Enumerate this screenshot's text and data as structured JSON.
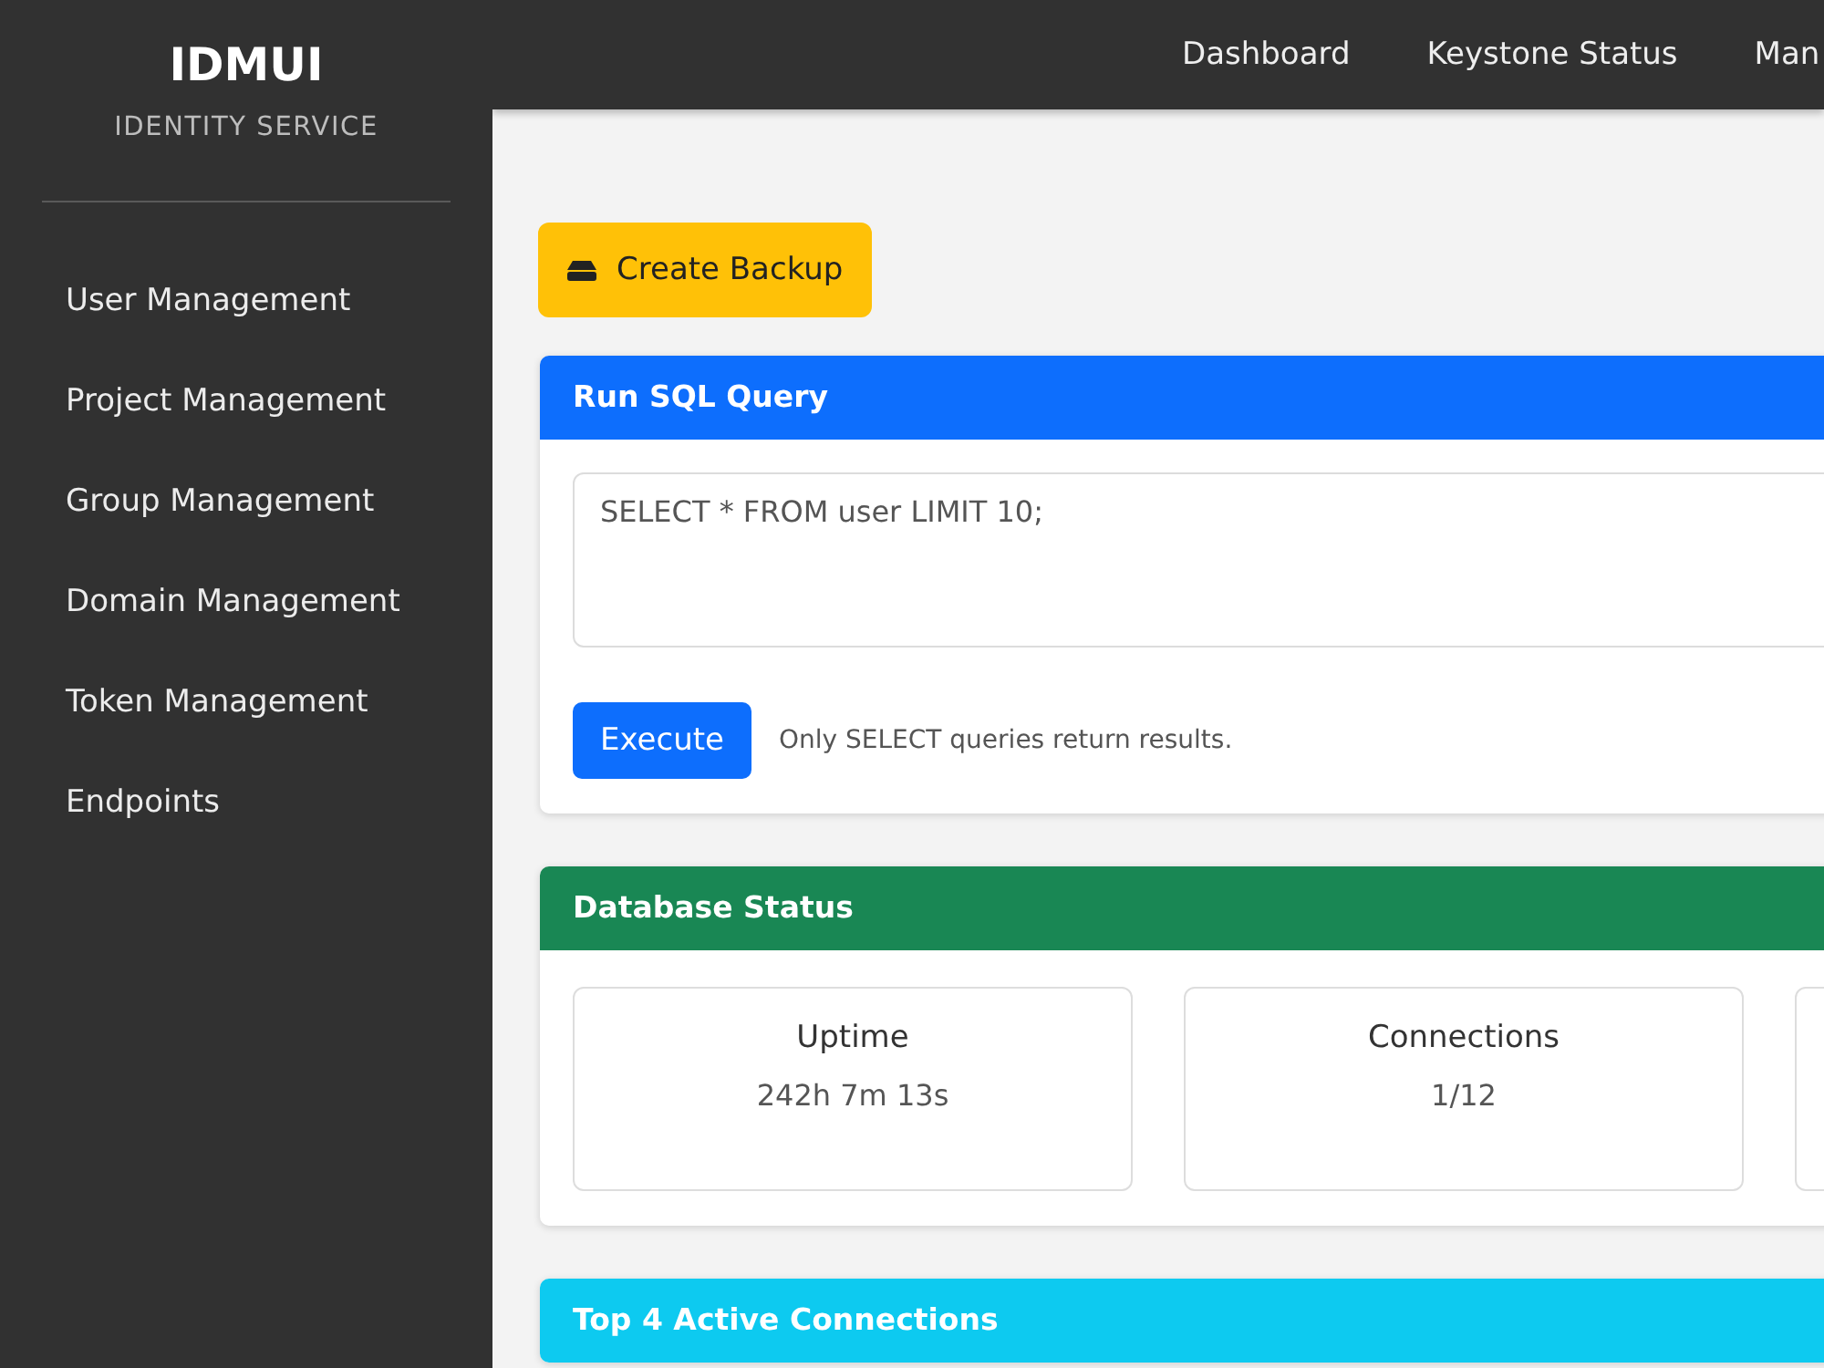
{
  "sidebar": {
    "title": "IDMUI",
    "subtitle": "IDENTITY SERVICE",
    "items": [
      {
        "label": "User Management"
      },
      {
        "label": "Project Management"
      },
      {
        "label": "Group Management"
      },
      {
        "label": "Domain Management"
      },
      {
        "label": "Token Management"
      },
      {
        "label": "Endpoints"
      }
    ]
  },
  "topbar": {
    "links": [
      {
        "label": "Dashboard"
      },
      {
        "label": "Keystone Status"
      },
      {
        "label": "Man"
      }
    ]
  },
  "backup_button": {
    "label": "Create Backup"
  },
  "cards": [
    {
      "kind": "query",
      "title": "Run SQL Query",
      "color": "#0d6efd",
      "query": {
        "value": "SELECT * FROM user LIMIT 10;"
      },
      "button": "Execute",
      "hint": "Only SELECT queries return results."
    },
    {
      "kind": "stats",
      "title": "Database Status",
      "color": "#198754",
      "stats": [
        {
          "kind": "tile",
          "label": "Uptime",
          "value": "242h 7m 13s"
        },
        {
          "kind": "tile",
          "label": "Connections",
          "value": "1/12"
        },
        {
          "kind": "edge"
        }
      ]
    },
    {
      "kind": "connections",
      "title": "Top 4 Active Connections",
      "color": "#0dcaf0"
    }
  ]
}
